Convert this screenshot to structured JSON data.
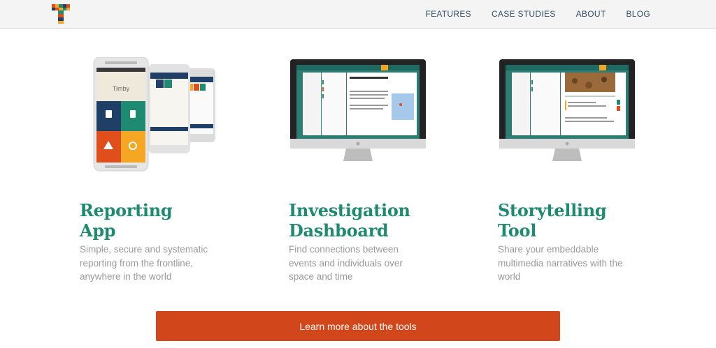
{
  "nav": {
    "links": [
      "FEATURES",
      "CASE STUDIES",
      "ABOUT",
      "BLOG"
    ]
  },
  "products": [
    {
      "title_line1": "Reporting",
      "title_line2": "App",
      "description": "Simple, secure and systematic reporting from the frontline, anywhere in the world",
      "screen_text": "Timby"
    },
    {
      "title_line1": "Investigation",
      "title_line2": "Dashboard",
      "description": "Find connections between events and individuals over space and time"
    },
    {
      "title_line1": "Storytelling",
      "title_line2": "Tool",
      "description": "Share your embeddable multimedia narratives with the world"
    }
  ],
  "cta": {
    "label": "Learn more about the tools"
  },
  "colors": {
    "accent_green": "#1e8a72",
    "cta_orange": "#d2461b",
    "nav_text": "#34506b",
    "tile_blue": "#1f3f66",
    "tile_green": "#1e8a72",
    "tile_orange": "#e04e1c",
    "tile_yellow": "#f5a623"
  }
}
